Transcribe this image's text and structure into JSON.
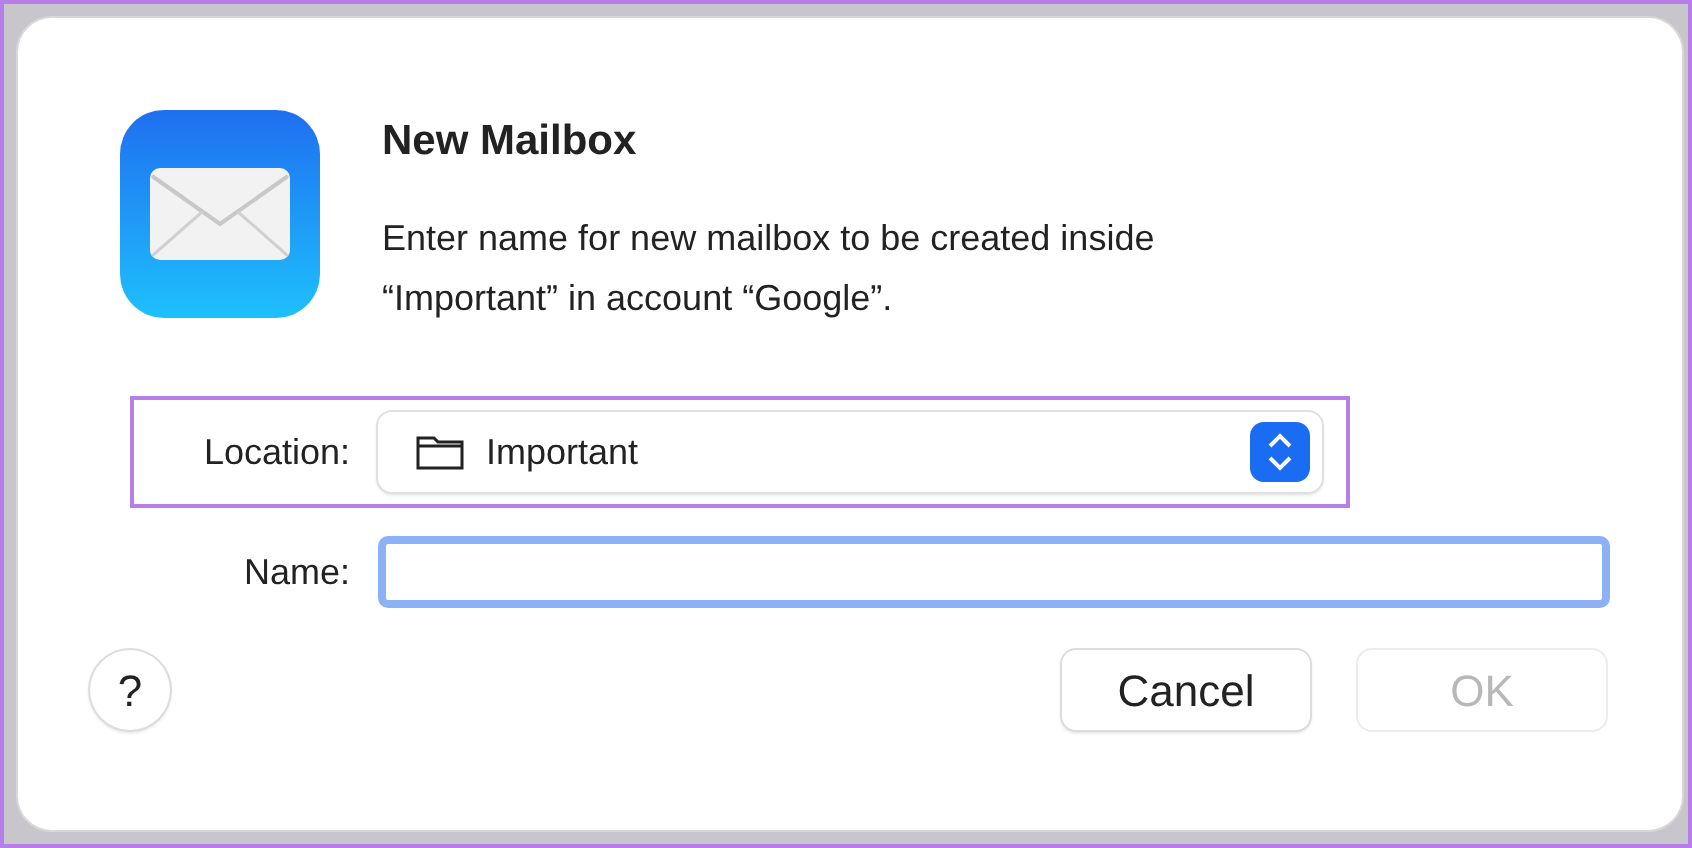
{
  "dialog": {
    "title": "New Mailbox",
    "message": "Enter name for new mailbox to be created inside “Important” in account “Google”.",
    "location": {
      "label": "Location:",
      "value": "Important",
      "highlighted": true
    },
    "name": {
      "label": "Name:",
      "focused": true
    },
    "help": "?",
    "buttons": [
      {
        "label": "Cancel",
        "disabled": false
      },
      {
        "label": "OK",
        "disabled": true
      }
    ]
  }
}
